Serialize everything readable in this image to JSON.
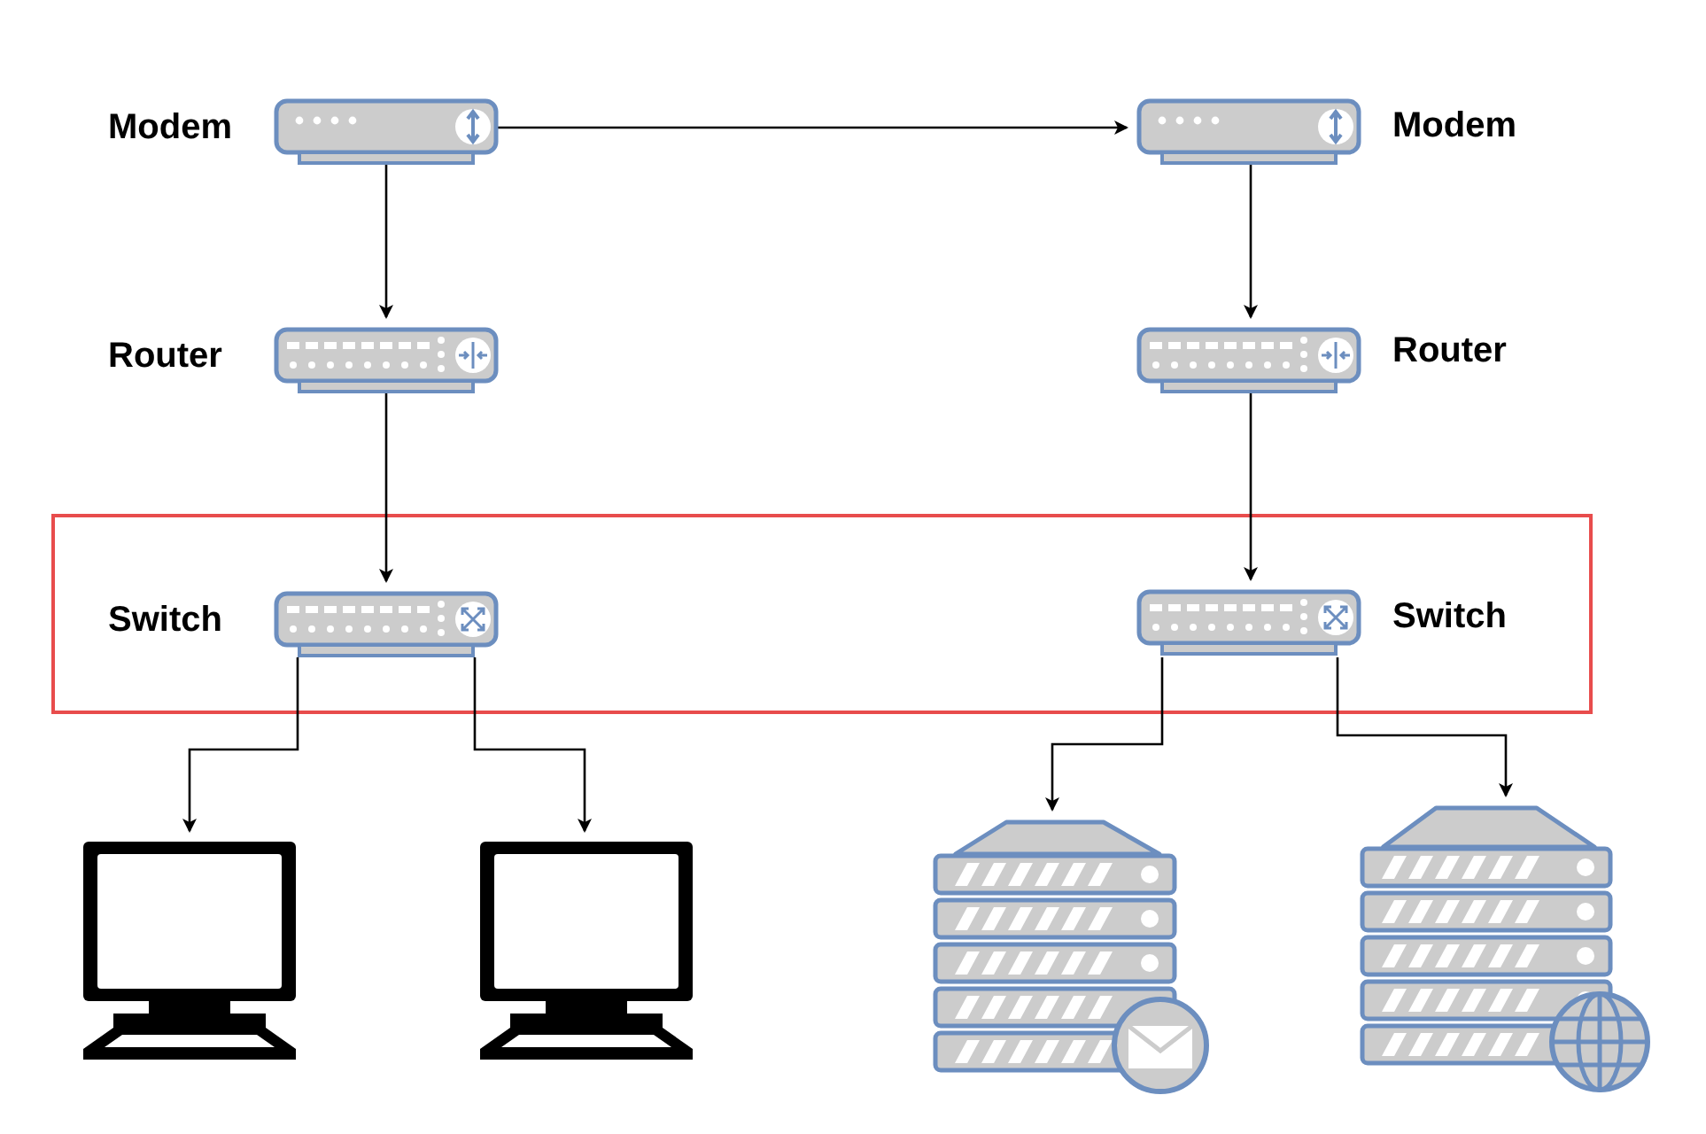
{
  "diagram": {
    "nodes": [
      {
        "kind": "modem",
        "label": "Modem"
      },
      {
        "kind": "router",
        "label": "Router"
      },
      {
        "kind": "switch",
        "label": "Switch"
      },
      {
        "kind": "modem",
        "label": "Modem"
      },
      {
        "kind": "router",
        "label": "Router"
      },
      {
        "kind": "switch",
        "label": "Switch"
      },
      {
        "kind": "computer"
      },
      {
        "kind": "computer"
      },
      {
        "kind": "mail-server"
      },
      {
        "kind": "web-server"
      }
    ]
  }
}
